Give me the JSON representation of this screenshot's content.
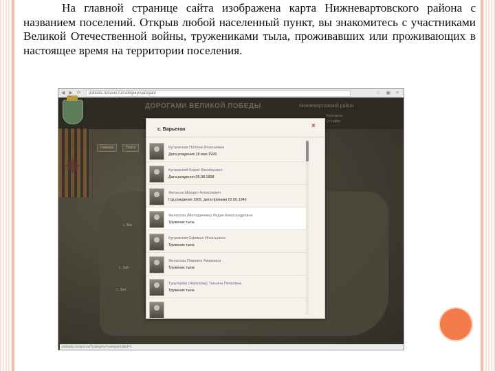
{
  "slide": {
    "paragraph": "На главной странице сайта изображена карта Нижневартовского района с названием поселений. Открыв любой населенный пункт, вы знакомитесь с участниками Великой Отечественной войны, тружениками тыла, проживавших или проживающих в настоящее время на территории поселения."
  },
  "browser": {
    "url": "pobeda.nvraion.ru/category/varegan/",
    "nav_icons": "◀ ▶ ⟳",
    "tool_icons": "☆ ▣ ≡",
    "footer_url": "pobeda.nvraion.ru/?category=vareganrs&id=1"
  },
  "site": {
    "title": "ДОРОГАМИ ВЕЛИКОЙ ПОБЕДЫ",
    "region": "Нижневартовский район",
    "links": [
      "Контакты",
      "О сайте"
    ],
    "menu": [
      "Главная",
      "Поиск"
    ],
    "map_labels": [
      "с. Ваг",
      "с. Зай",
      "с. Зал"
    ]
  },
  "modal": {
    "title": "с. Варьеган",
    "close_symbol": "×",
    "people": [
      {
        "name": "Кугаевская Полина Игнатьевна",
        "info": "Дата рождения 18 мая 1920"
      },
      {
        "name": "Кугаевский Борис Васильевич",
        "info": "Дата рождения 05.08.1898"
      },
      {
        "name": "Филатов Михаил Алексеевич",
        "info": "Год рождения 1905, дата призыва 02.06.1942"
      },
      {
        "name": "Филатова (Мелодичева) Лидия Александровна",
        "info": "Труженик тыла"
      },
      {
        "name": "Кугаевская Ефимья Игнатьевна",
        "info": "Труженик тыла"
      },
      {
        "name": "Филатова Павлина Акимовна",
        "info": "Труженик тыла"
      },
      {
        "name": "Турунцева (Черезова) Татьяна Петровна",
        "info": "Труженик тыла"
      },
      {
        "name": "",
        "info": ""
      }
    ]
  },
  "colors": {
    "accent": "#f47c4a",
    "stripe": "#f2b79e",
    "site_background": "#3d3a2f",
    "modal_background": "#f4f2ea",
    "close": "#c0392b"
  }
}
